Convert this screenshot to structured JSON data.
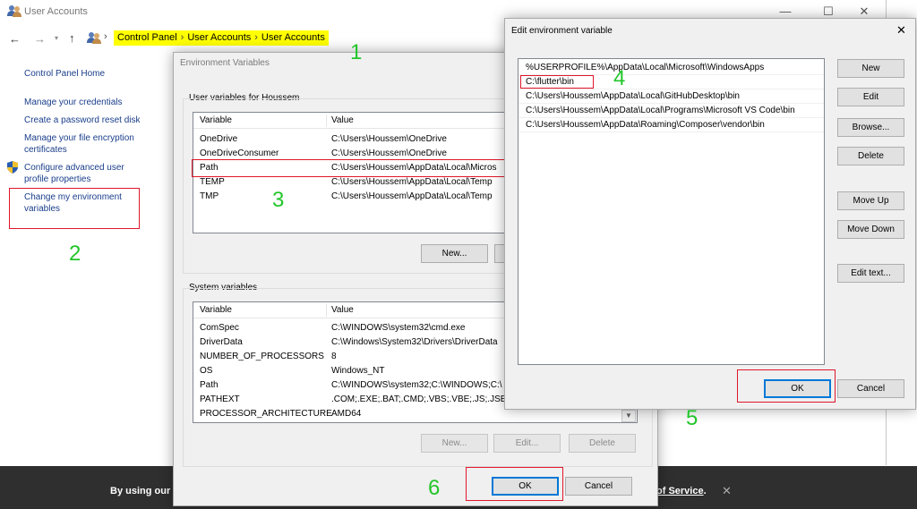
{
  "user_accounts": {
    "title": "User Accounts",
    "breadcrumb": [
      "Control Panel",
      "User Accounts",
      "User Accounts"
    ],
    "sidebar": {
      "home": "Control Panel Home",
      "links": [
        "Manage your credentials",
        "Create a password reset disk",
        "Manage your file encryption",
        "certificates",
        "Configure advanced user",
        "profile properties",
        "Change my environment",
        "variables"
      ]
    }
  },
  "env_dialog": {
    "title": "Environment Variables",
    "user_group_label": "User variables for Houssem",
    "columns": [
      "Variable",
      "Value"
    ],
    "user_vars": [
      {
        "name": "OneDrive",
        "value": "C:\\Users\\Houssem\\OneDrive"
      },
      {
        "name": "OneDriveConsumer",
        "value": "C:\\Users\\Houssem\\OneDrive"
      },
      {
        "name": "Path",
        "value": "C:\\Users\\Houssem\\AppData\\Local\\Micros"
      },
      {
        "name": "TEMP",
        "value": "C:\\Users\\Houssem\\AppData\\Local\\Temp"
      },
      {
        "name": "TMP",
        "value": "C:\\Users\\Houssem\\AppData\\Local\\Temp"
      }
    ],
    "user_new_btn": "New...",
    "system_group_label": "System variables",
    "system_vars": [
      {
        "name": "ComSpec",
        "value": "C:\\WINDOWS\\system32\\cmd.exe"
      },
      {
        "name": "DriverData",
        "value": "C:\\Windows\\System32\\Drivers\\DriverData"
      },
      {
        "name": "NUMBER_OF_PROCESSORS",
        "value": "8"
      },
      {
        "name": "OS",
        "value": "Windows_NT"
      },
      {
        "name": "Path",
        "value": "C:\\WINDOWS\\system32;C:\\WINDOWS;C:\\"
      },
      {
        "name": "PATHEXT",
        "value": ".COM;.EXE;.BAT;.CMD;.VBS;.VBE;.JS;.JSE;.W"
      },
      {
        "name": "PROCESSOR_ARCHITECTURE",
        "value": "AMD64"
      }
    ],
    "system_new_btn": "New...",
    "system_edit_btn": "Edit...",
    "system_delete_btn": "Delete",
    "ok": "OK",
    "cancel": "Cancel"
  },
  "edit_dialog": {
    "title": "Edit environment variable",
    "close": "✕",
    "entries": [
      "%USERPROFILE%\\AppData\\Local\\Microsoft\\WindowsApps",
      "C:\\flutter\\bin",
      "C:\\Users\\Houssem\\AppData\\Local\\GitHubDesktop\\bin",
      "C:\\Users\\Houssem\\AppData\\Local\\Programs\\Microsoft VS Code\\bin",
      "C:\\Users\\Houssem\\AppData\\Roaming\\Composer\\vendor\\bin"
    ],
    "buttons": {
      "new": "New",
      "edit": "Edit",
      "browse": "Browse...",
      "delete": "Delete",
      "move_up": "Move Up",
      "move_down": "Move Down",
      "edit_text": "Edit text..."
    },
    "ok": "OK",
    "cancel": "Cancel"
  },
  "annotations": [
    "1",
    "2",
    "3",
    "4",
    "5",
    "6"
  ],
  "cookie_bar": {
    "text_left": "By using our s",
    "text_right": "of Service",
    "period": ".",
    "close": "✕"
  },
  "colors": {
    "highlight": "#ffff00",
    "annotation_green": "#22c62a",
    "annotation_red": "#e0162b",
    "link_blue": "#1a3e8b",
    "focus_blue": "#0078d7"
  }
}
